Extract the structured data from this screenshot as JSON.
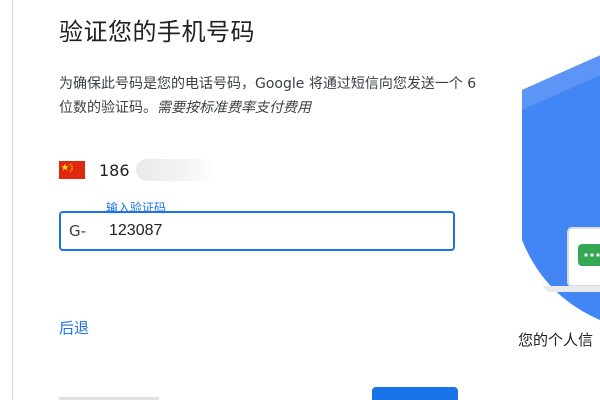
{
  "page": {
    "title": "验证您的手机号码",
    "description_plain": "为确保此号码是您的电话号码，Google 将通过短信向您发送一个 6 位数的验证码。",
    "description_italic": "需要按标准费率支付费用",
    "phone_prefix": "186",
    "country_flag": "china-flag-icon"
  },
  "verification": {
    "label": "输入验证码",
    "prefix": "G-",
    "value": "123087"
  },
  "actions": {
    "back_label": "后退"
  },
  "illustration": {
    "caption": "您的个人信",
    "shield_color": "#4285f4",
    "badge_color": "#34a853"
  },
  "colors": {
    "accent": "#1a73e8",
    "text": "#202124",
    "flag_red": "#de2910",
    "flag_yellow": "#ffde00"
  }
}
